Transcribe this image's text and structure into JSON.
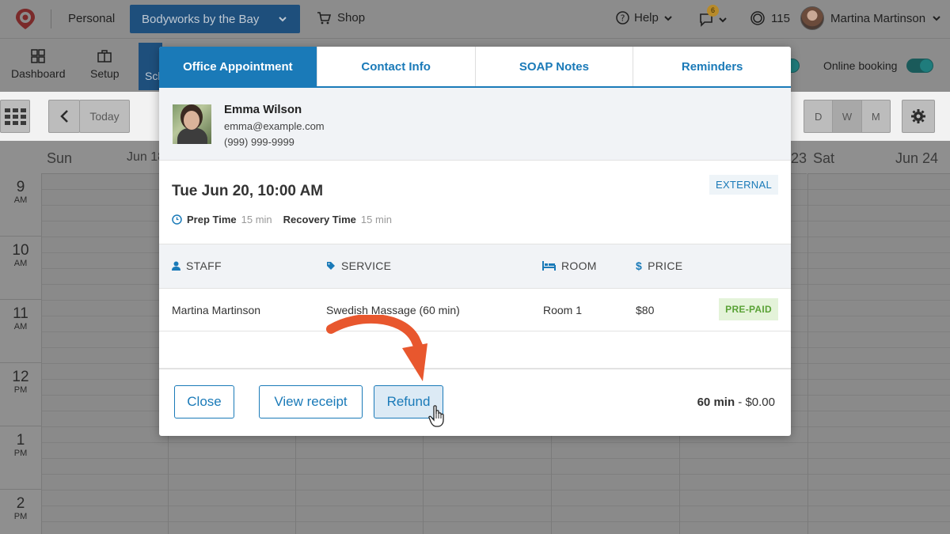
{
  "topbar": {
    "personal": "Personal",
    "business": "Bodyworks by the Bay",
    "shop": "Shop",
    "help": "Help",
    "notifications": "6",
    "points": "115",
    "user": "Martina Martinson"
  },
  "toolbar": {
    "dashboard": "Dashboard",
    "setup": "Setup",
    "schedule_partial": "Sch",
    "online_booking": "Online booking"
  },
  "calendar": {
    "today": "Today",
    "view_d": "D",
    "view_w": "W",
    "view_m": "M",
    "days": [
      {
        "name": "Sun",
        "date": "Jun 18"
      },
      {
        "name": "Sat",
        "date": "Jun 24"
      }
    ],
    "partial_date": "23",
    "hours": [
      {
        "h": "9",
        "ap": "AM"
      },
      {
        "h": "10",
        "ap": "AM"
      },
      {
        "h": "11",
        "ap": "AM"
      },
      {
        "h": "12",
        "ap": "PM"
      },
      {
        "h": "1",
        "ap": "PM"
      },
      {
        "h": "2",
        "ap": "PM"
      }
    ]
  },
  "modal": {
    "tabs": [
      "Office Appointment",
      "Contact Info",
      "SOAP Notes",
      "Reminders"
    ],
    "client": {
      "name": "Emma Wilson",
      "email": "emma@example.com",
      "phone": "(999) 999-9999"
    },
    "appointment": {
      "datetime": "Tue Jun 20, 10:00 AM",
      "badge": "EXTERNAL",
      "prep_label": "Prep Time",
      "prep_value": "15 min",
      "recovery_label": "Recovery Time",
      "recovery_value": "15 min"
    },
    "table": {
      "headers": {
        "staff": "STAFF",
        "service": "SERVICE",
        "room": "ROOM",
        "price": "PRICE"
      },
      "row": {
        "staff": "Martina Martinson",
        "service": "Swedish Massage (60 min)",
        "room": "Room 1",
        "price": "$80",
        "status": "PRE-PAID"
      }
    },
    "footer": {
      "close": "Close",
      "view_receipt": "View receipt",
      "refund": "Refund",
      "total_duration": "60 min",
      "total_amount": " - $0.00"
    }
  },
  "colors": {
    "accent": "#1a7ab8",
    "annotation_arrow": "#e8572e",
    "prepaid_text": "#5aa236"
  }
}
